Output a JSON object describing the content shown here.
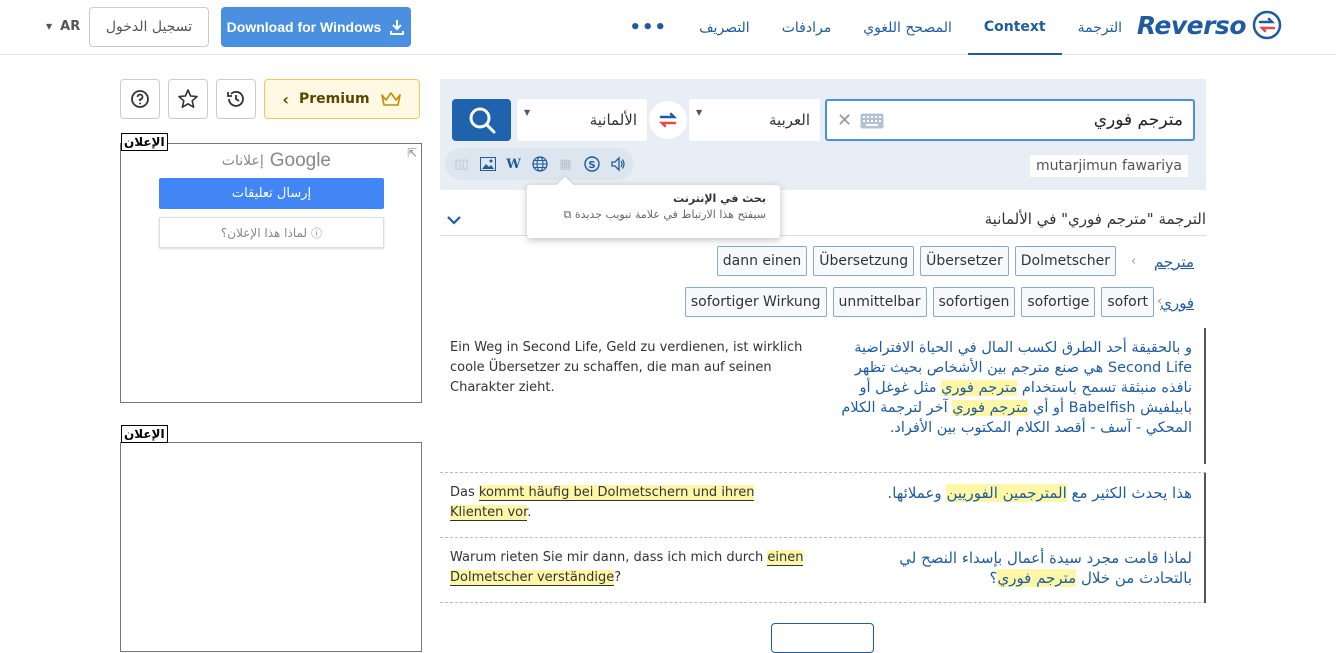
{
  "header": {
    "logo": "Reverso",
    "nav": [
      {
        "label": "الترجمة",
        "active": false
      },
      {
        "label": "Context",
        "active": true
      },
      {
        "label": "المصحح اللغوي",
        "active": false
      },
      {
        "label": "مرادفات",
        "active": false
      },
      {
        "label": "التصريف",
        "active": false
      },
      {
        "label": "•••",
        "active": false
      }
    ],
    "download_label": "Download for Windows",
    "login_label": "تسجيل الدخول",
    "lang_label": "AR"
  },
  "sidebar": {
    "premium_label": "Premium",
    "ad_label_1": "الإعلان",
    "ad_label_2": "الإعلان",
    "google_ads_label": "إعلانات",
    "google_word": "Google",
    "send_feedback": "إرسال تعليقات",
    "why_ad": "لماذا هذا الإعلان؟"
  },
  "search": {
    "query": "مترجم فوري",
    "source_lang": "العربية",
    "target_lang": "الألمانية",
    "transliteration": "mutarjimun fawariya"
  },
  "tooltip": {
    "title": "بحث في الإنترنت",
    "subtitle": "سيفتح هذا الارتباط في علامة تبويب جديدة"
  },
  "results": {
    "title": "الترجمة \"مترجم فوري\" في الألمانية",
    "rows": [
      {
        "word": "مترجم",
        "translations": [
          "Dolmetscher",
          "Übersetzer",
          "Übersetzung",
          "dann einen"
        ]
      },
      {
        "word": "فوري",
        "translations": [
          "sofort",
          "sofortige",
          "sofortigen",
          "unmittelbar",
          "sofortiger Wirkung"
        ]
      }
    ]
  },
  "examples": [
    {
      "de": "Ein Weg in Second Life, Geld zu verdienen, ist wirklich coole Übersetzer zu schaffen, die man auf seinen Charakter zieht.",
      "ar_parts": [
        "و بالحقيقة أحد الطرق لكسب المال في الحياة الافتراضية Second Life هي صنع مترجم بين الأشخاص بحيث تظهر نافذه منبثقة تسمح باستخدام ",
        "مترجم فوري",
        " مثل غوغل أو بابيلفيش Babelfish أو أي ",
        "مترجم فوري",
        " آخر لترجمة الكلام المحكي - آسف - أقصد الكلام المكتوب بين الأفراد."
      ]
    },
    {
      "de_parts": [
        "Das ",
        "kommt häufig bei Dolmetschern und ihren Klienten vor",
        "."
      ],
      "ar_parts": [
        "هذا يحدث الكثير مع ",
        "المترجمين الفوريين",
        " وعملائها."
      ]
    },
    {
      "de_parts": [
        "Warum rieten Sie mir dann, dass ich mich durch ",
        "einen Dolmetscher verständige",
        "?"
      ],
      "ar_parts": [
        "لماذا قامت مجرد سيدة أعمال بإسداء النصح لي بالتحادث من خلال ",
        "مترجم فوري",
        "؟"
      ]
    }
  ],
  "colors": {
    "brand": "#1f5b9e",
    "accent": "#4a8fe0",
    "highlight": "#fff7a8",
    "panel": "#e8eef5"
  }
}
